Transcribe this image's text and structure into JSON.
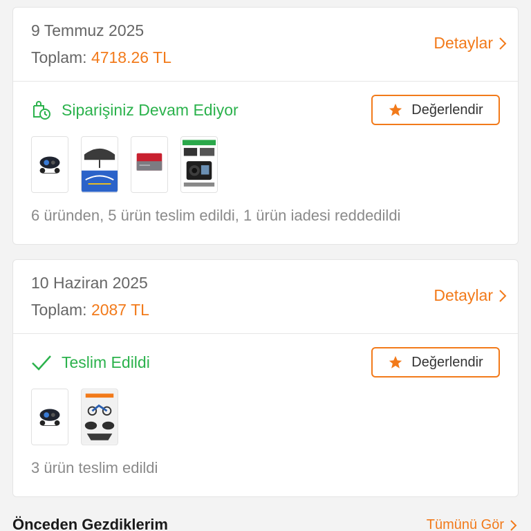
{
  "orders": [
    {
      "date": "9 Temmuz 2025",
      "total_label": "Toplam:",
      "total_value": "4718.26 TL",
      "details_label": "Detaylar",
      "status": "Siparişiniz Devam Ediyor",
      "status_icon": "shopping-bag-clock-icon",
      "rate_label": "Değerlendir",
      "summary": "6 üründen, 5 ürün teslim edildi, 1 ürün iadesi reddedildi",
      "products": [
        "motorcycle-intercom",
        "car-sunshade-umbrella",
        "sd-card",
        "dash-camera"
      ]
    },
    {
      "date": "10 Haziran 2025",
      "total_label": "Toplam:",
      "total_value": "2087 TL",
      "details_label": "Detaylar",
      "status": "Teslim Edildi",
      "status_icon": "check-icon",
      "rate_label": "Değerlendir",
      "summary": "3 ürün teslim edildi",
      "products": [
        "motorcycle-intercom",
        "motorcycle-accessory"
      ]
    }
  ],
  "recently_viewed": {
    "title": "Önceden Gezdiklerim",
    "see_all_label": "Tümünü Gör"
  },
  "colors": {
    "accent": "#f27a1a",
    "success": "#2bb24c",
    "text": "#666666",
    "muted": "#8a8a8a"
  }
}
